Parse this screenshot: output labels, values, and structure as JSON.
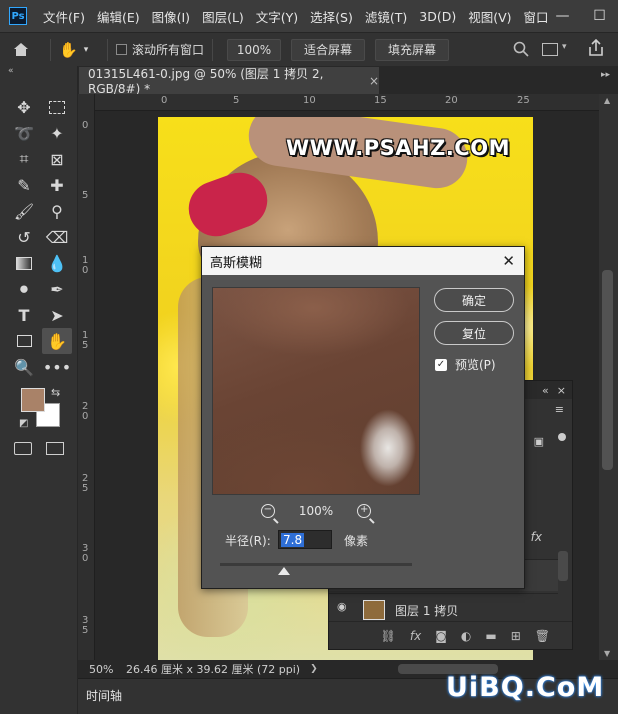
{
  "app": {
    "logo": "Ps"
  },
  "menu": [
    "文件(F)",
    "编辑(E)",
    "图像(I)",
    "图层(L)",
    "文字(Y)",
    "选择(S)",
    "滤镜(T)",
    "3D(D)",
    "视图(V)",
    "窗口"
  ],
  "options_bar": {
    "scroll_all_windows": "滚动所有窗口",
    "zoom": "100%",
    "fit_screen": "适合屏幕",
    "fill_screen": "填充屏幕"
  },
  "document": {
    "tab_title": "01315L461-0.jpg @ 50% (图层 1 拷贝 2, RGB/8#) *",
    "watermark": "WWW.PSAHZ.COM"
  },
  "ruler": {
    "top": [
      "0",
      "5",
      "10",
      "15",
      "20",
      "25"
    ],
    "left": [
      "0",
      "5",
      "1\n0",
      "1\n5",
      "2\n0",
      "2\n5",
      "3\n0",
      "3\n5"
    ]
  },
  "dialog": {
    "title": "高斯模糊",
    "ok_label": "确定",
    "reset_label": "复位",
    "preview_label": "预览(P)",
    "preview_checked": true,
    "zoom_level": "100%",
    "radius_label": "半径(R):",
    "radius_value": "7.8",
    "radius_unit": "像素"
  },
  "layers_panel": {
    "layer_name": "图层 1 拷贝"
  },
  "status": {
    "zoom": "50%",
    "doc_size": "26.46 厘米 x 39.62 厘米 (72 ppi)"
  },
  "timeline": {
    "label": "时间轴"
  },
  "colors": {
    "foreground": "#a98268",
    "background": "#ffffff",
    "accent": "#31a8ff"
  },
  "site_watermark": "UiBQ.CoM"
}
